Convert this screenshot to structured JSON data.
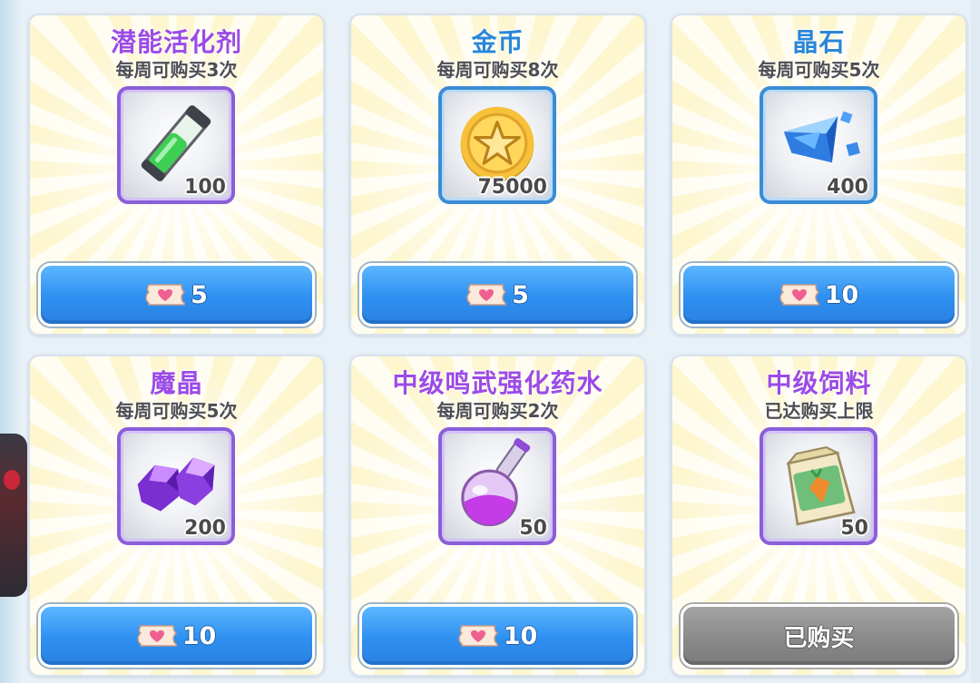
{
  "colors": {
    "name_purple": "#9b4be6",
    "name_blue": "#2a86d8",
    "button_blue": "#2e8ff0",
    "button_grey": "#888888",
    "tile_purple": "#8a5fd8",
    "tile_blue": "#3b8bd6"
  },
  "shop": {
    "items": [
      {
        "name": "潜能活化剂",
        "limit": "每周可购买3次",
        "quantity": "100",
        "price": "5",
        "icon": "potential-activator-icon",
        "name_color": "#9b4be6",
        "tile": "purple",
        "state": "available"
      },
      {
        "name": "金币",
        "limit": "每周可购买8次",
        "quantity": "75000",
        "price": "5",
        "icon": "gold-coin-icon",
        "name_color": "#2a86d8",
        "tile": "blue",
        "state": "available"
      },
      {
        "name": "晶石",
        "limit": "每周可购买5次",
        "quantity": "400",
        "price": "10",
        "icon": "crystal-stone-icon",
        "name_color": "#2a86d8",
        "tile": "blue",
        "state": "available"
      },
      {
        "name": "魔晶",
        "limit": "每周可购买5次",
        "quantity": "200",
        "price": "10",
        "icon": "magic-crystal-icon",
        "name_color": "#9b4be6",
        "tile": "purple",
        "state": "available"
      },
      {
        "name": "中级鸣武强化药水",
        "limit": "每周可购买2次",
        "quantity": "50",
        "price": "10",
        "icon": "potion-flask-icon",
        "name_color": "#9b4be6",
        "tile": "purple",
        "state": "available"
      },
      {
        "name": "中级饲料",
        "limit": "已达购买上限",
        "quantity": "50",
        "price": "",
        "icon": "feed-bag-icon",
        "name_color": "#9b4be6",
        "tile": "purple",
        "state": "purchased",
        "button_label": "已购买"
      }
    ],
    "currency_icon": "heart-ticket-icon"
  }
}
